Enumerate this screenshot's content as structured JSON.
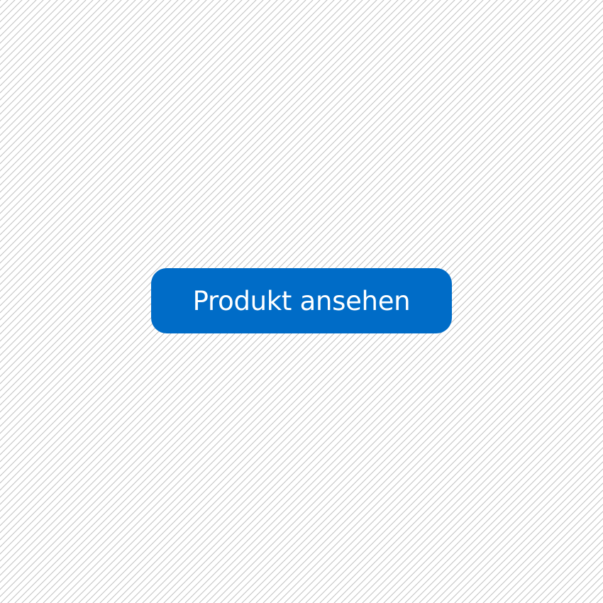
{
  "button": {
    "label": "Produkt ansehen",
    "color": "#006cc7"
  }
}
